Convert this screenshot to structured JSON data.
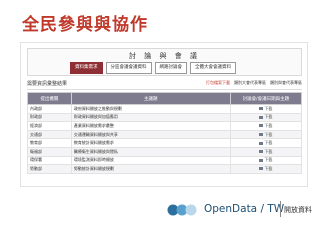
{
  "slide": {
    "title": "全民參與與協作"
  },
  "forum": {
    "title": "討 論 與 會 議",
    "tabs": [
      "資料集需求",
      "分區會議會議資料",
      "網路討論會",
      "全體大會會議資料"
    ]
  },
  "subbar": {
    "title": "需要資訊彙整結果",
    "actions": [
      "打包檔案下載",
      "類別大會代表專區",
      "類別與會代表專區"
    ]
  },
  "table": {
    "headers": [
      "提出機關",
      "主議題",
      "討論會/會議日期與主題"
    ],
    "download_label": "下載",
    "rows": [
      {
        "agency": "內政部",
        "topic": "政府資料開放之推動與規劃"
      },
      {
        "agency": "財政部",
        "topic": "財政資料開放與加值應用"
      },
      {
        "agency": "經濟部",
        "topic": "產業資料開放需求彙整"
      },
      {
        "agency": "交通部",
        "topic": "交通運輸資料開放與共享"
      },
      {
        "agency": "教育部",
        "topic": "教育統計資料開放需求"
      },
      {
        "agency": "衛福部",
        "topic": "醫療衛生資料開放與隱私"
      },
      {
        "agency": "環保署",
        "topic": "環境監測資料即時開放"
      },
      {
        "agency": "勞動部",
        "topic": "勞動統計資料開放規劃"
      }
    ]
  },
  "brand": {
    "name": "OpenData / TW",
    "sub": "開放資料"
  }
}
